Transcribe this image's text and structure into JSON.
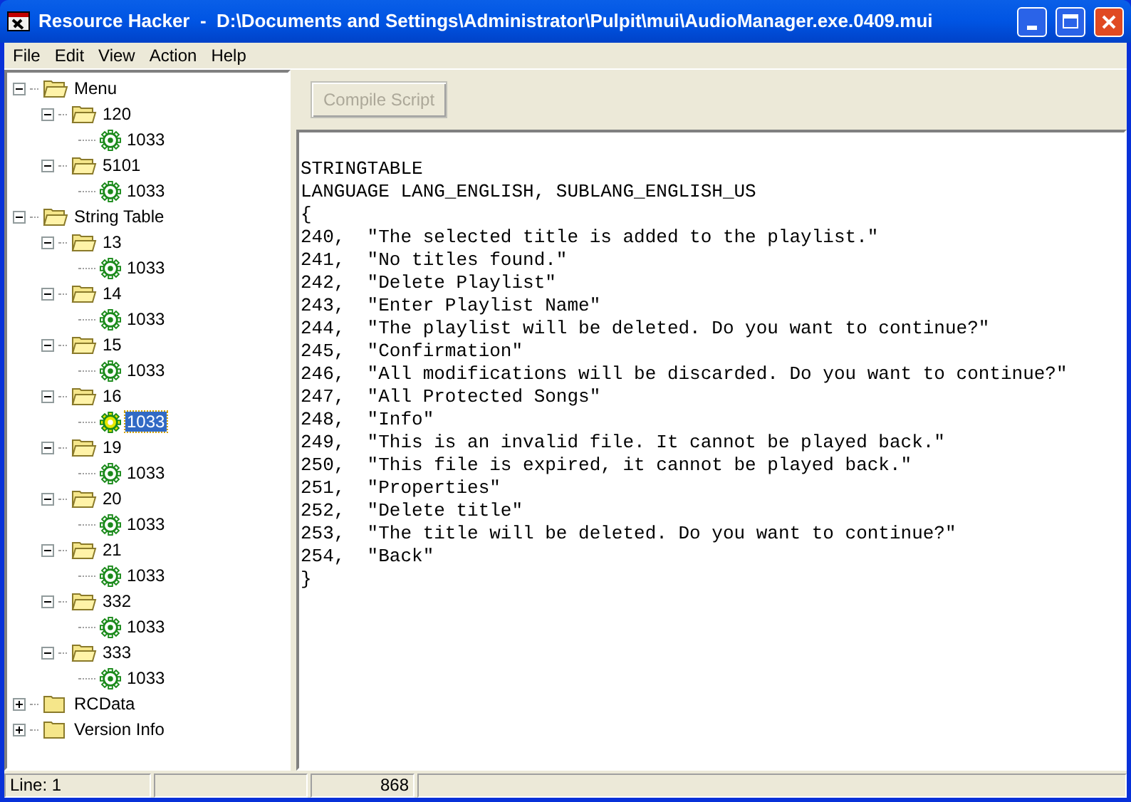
{
  "window": {
    "title": "Resource Hacker  -  D:\\Documents and Settings\\Administrator\\Pulpit\\mui\\AudioManager.exe.0409.mui"
  },
  "menu": [
    "File",
    "Edit",
    "View",
    "Action",
    "Help"
  ],
  "tree": [
    {
      "label": "Menu",
      "kind": "folder",
      "expanded": true,
      "children": [
        {
          "label": "120",
          "kind": "folder",
          "expanded": true,
          "children": [
            {
              "label": "1033",
              "kind": "leaf",
              "selected": false
            }
          ]
        },
        {
          "label": "5101",
          "kind": "folder",
          "expanded": true,
          "children": [
            {
              "label": "1033",
              "kind": "leaf",
              "selected": false
            }
          ]
        }
      ]
    },
    {
      "label": "String Table",
      "kind": "folder",
      "expanded": true,
      "children": [
        {
          "label": "13",
          "kind": "folder",
          "expanded": true,
          "children": [
            {
              "label": "1033",
              "kind": "leaf",
              "selected": false
            }
          ]
        },
        {
          "label": "14",
          "kind": "folder",
          "expanded": true,
          "children": [
            {
              "label": "1033",
              "kind": "leaf",
              "selected": false
            }
          ]
        },
        {
          "label": "15",
          "kind": "folder",
          "expanded": true,
          "children": [
            {
              "label": "1033",
              "kind": "leaf",
              "selected": false
            }
          ]
        },
        {
          "label": "16",
          "kind": "folder",
          "expanded": true,
          "children": [
            {
              "label": "1033",
              "kind": "leaf",
              "selected": true
            }
          ]
        },
        {
          "label": "19",
          "kind": "folder",
          "expanded": true,
          "children": [
            {
              "label": "1033",
              "kind": "leaf",
              "selected": false
            }
          ]
        },
        {
          "label": "20",
          "kind": "folder",
          "expanded": true,
          "children": [
            {
              "label": "1033",
              "kind": "leaf",
              "selected": false
            }
          ]
        },
        {
          "label": "21",
          "kind": "folder",
          "expanded": true,
          "children": [
            {
              "label": "1033",
              "kind": "leaf",
              "selected": false
            }
          ]
        },
        {
          "label": "332",
          "kind": "folder",
          "expanded": true,
          "children": [
            {
              "label": "1033",
              "kind": "leaf",
              "selected": false
            }
          ]
        },
        {
          "label": "333",
          "kind": "folder",
          "expanded": true,
          "children": [
            {
              "label": "1033",
              "kind": "leaf",
              "selected": false
            }
          ]
        }
      ]
    },
    {
      "label": "RCData",
      "kind": "folder",
      "expanded": false
    },
    {
      "label": "Version Info",
      "kind": "folder",
      "expanded": false
    }
  ],
  "toolbar": {
    "compile_button": {
      "label": "Compile Script",
      "disabled": true
    }
  },
  "editor": {
    "lines": [
      "STRINGTABLE",
      "LANGUAGE LANG_ENGLISH, SUBLANG_ENGLISH_US",
      "{",
      "240,  \"The selected title is added to the playlist.\"",
      "241,  \"No titles found.\"",
      "242,  \"Delete Playlist\"",
      "243,  \"Enter Playlist Name\"",
      "244,  \"The playlist will be deleted. Do you want to continue?\"",
      "245,  \"Confirmation\"",
      "246,  \"All modifications will be discarded. Do you want to continue?\"",
      "247,  \"All Protected Songs\"",
      "248,  \"Info\"",
      "249,  \"This is an invalid file. It cannot be played back.\"",
      "250,  \"This file is expired, it cannot be played back.\"",
      "251,  \"Properties\"",
      "252,  \"Delete title\"",
      "253,  \"The title will be deleted. Do you want to continue?\"",
      "254,  \"Back\"",
      "}"
    ]
  },
  "status_bar": {
    "line": "Line: 1",
    "size": "868"
  }
}
